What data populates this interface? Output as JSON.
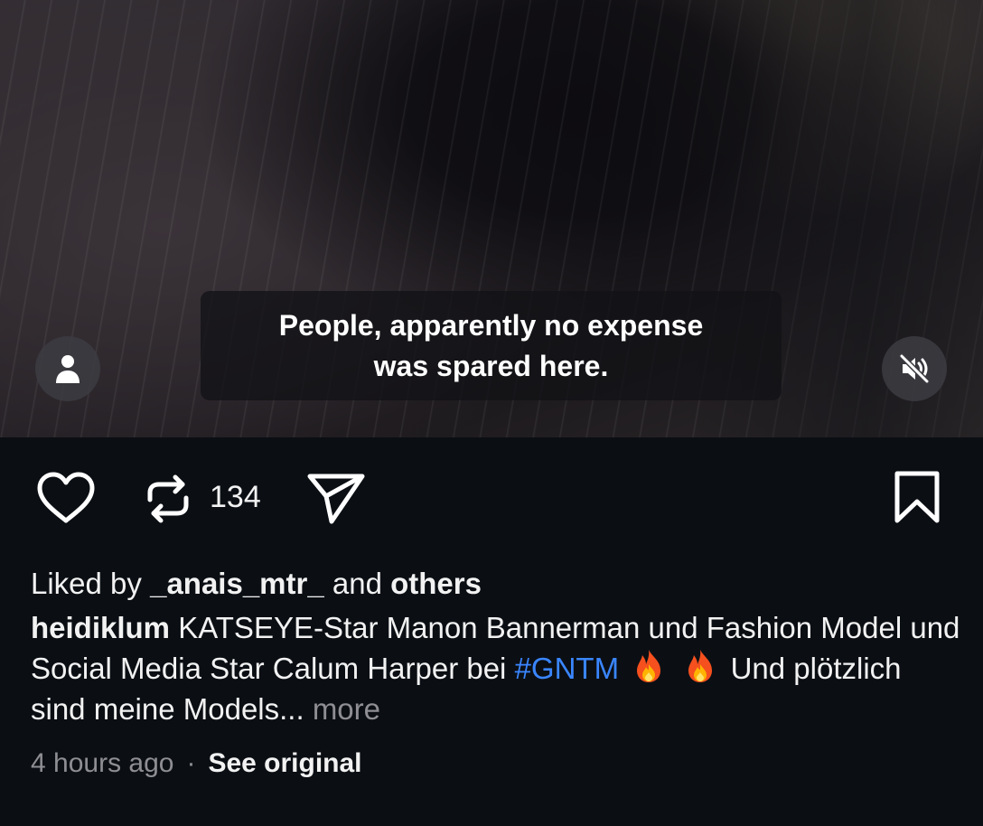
{
  "video": {
    "caption_line1": "People, apparently no expense",
    "caption_line2": "was spared here."
  },
  "icons": {
    "profile": "person-icon",
    "mute": "speaker-muted-icon",
    "like": "heart-icon",
    "repost": "repost-icon",
    "share": "send-icon",
    "save": "bookmark-icon",
    "emoji": "fire-emoji"
  },
  "actions": {
    "repost_count": "134"
  },
  "likes": {
    "prefix": "Liked by ",
    "user": "_anais_mtr_",
    "middle": " and ",
    "others": "others"
  },
  "post": {
    "username": "heidiklum",
    "text_part1": " KATSEYE-Star Manon Bannerman und Fashion Model und Social Media Star Calum Harper bei ",
    "hashtag": "#GNTM",
    "text_part2": " Und plötzlich sind meine Models...",
    "more": "more"
  },
  "meta": {
    "time": "4 hours ago",
    "separator": "·",
    "see_original": "See original"
  },
  "colors": {
    "background": "#0b0f14",
    "hashtag": "#3a86ff",
    "muted_text": "#8e8e93"
  }
}
